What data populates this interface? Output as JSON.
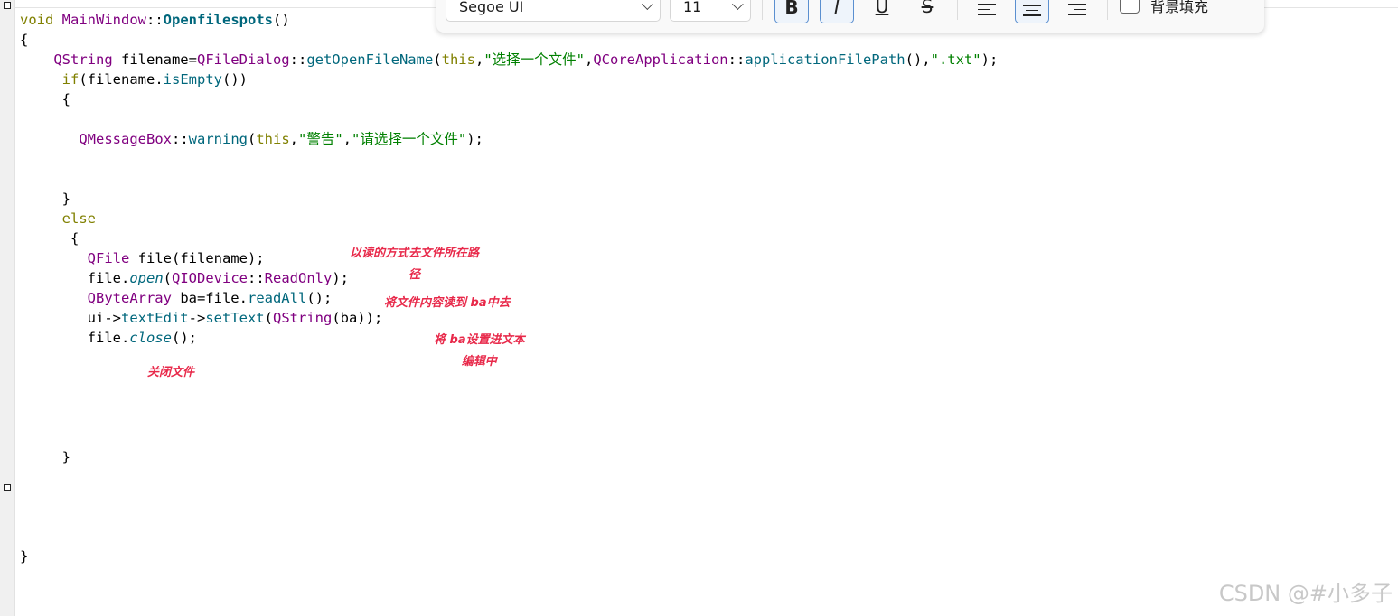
{
  "toolbar": {
    "font_family": "Segoe UI",
    "font_size": "11",
    "bold_glyph": "B",
    "italic_glyph": "I",
    "underline_glyph": "U",
    "strike_glyph": "S",
    "background_fill_label": "背景填充"
  },
  "code_lines": [
    "void MainWindow::Openfilespots()",
    "{",
    "    QString filename=QFileDialog::getOpenFileName(this,\"选择一个文件\",QCoreApplication::applicationFilePath(),\".txt\");",
    "     if(filename.isEmpty())",
    "     {",
    "",
    "       QMessageBox::warning(this,\"警告\",\"请选择一个文件\");",
    "",
    "",
    "     }",
    "     else",
    "      {",
    "        QFile file(filename);",
    "        file.open(QIODevice::ReadOnly);",
    "        QByteArray ba=file.readAll();",
    "        ui->textEdit->setText(QString(ba));",
    "        file.close();",
    "",
    "",
    "",
    "",
    "",
    "     }",
    "",
    "",
    "",
    "",
    "}"
  ],
  "annotations": {
    "read_mode_line1": "以读的方式去文件所在路",
    "read_mode_line2": "径",
    "read_to_ba": "将文件内容读到 ba中去",
    "set_text_line1": "将 ba设置进文本",
    "set_text_line2": "编辑中",
    "close_file": "关闭文件"
  },
  "watermark": "CSDN @#小多子",
  "colors": {
    "keyword": "#808000",
    "type": "#800080",
    "function": "#00677c",
    "string": "#008000",
    "annotation": "#e8294a"
  }
}
